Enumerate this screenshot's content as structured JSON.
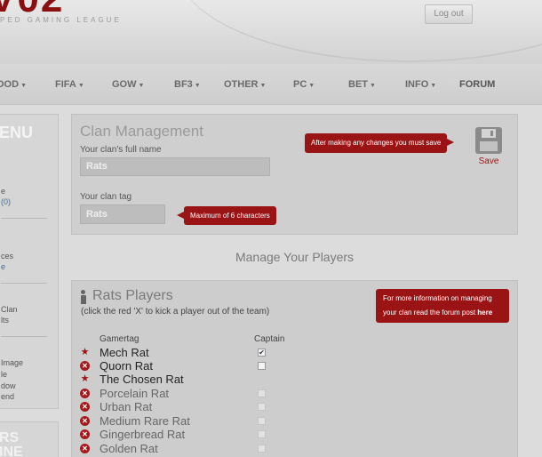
{
  "header": {
    "logo_text": "V02",
    "tagline": "PED GAMING LEAGUE",
    "logout_label": "Log out"
  },
  "nav": {
    "items": [
      {
        "label": "OOD",
        "caret": true
      },
      {
        "label": "FIFA",
        "caret": true
      },
      {
        "label": "GOW",
        "caret": true
      },
      {
        "label": "BF3",
        "caret": true
      },
      {
        "label": "OTHER",
        "caret": true
      },
      {
        "label": "PC",
        "caret": true
      },
      {
        "label": "BET",
        "caret": true
      },
      {
        "label": "INFO",
        "caret": true
      },
      {
        "label": "FORUM",
        "caret": false
      }
    ]
  },
  "sidebar": {
    "title": "ENU",
    "items": [
      "e",
      "(0)",
      "ces",
      "e",
      "Clan",
      "lts",
      "Image",
      "le",
      "dow",
      "end"
    ],
    "bottom_title_1": "RS",
    "bottom_title_2": "INE"
  },
  "clan": {
    "title": "Clan Management",
    "full_name_label": "Your clan's full name",
    "full_name_value": "Rats",
    "tag_label": "Your clan tag",
    "tag_value": "Rats",
    "save_hint": "After making any changes you must save",
    "tag_hint": "Maximum of 6 characters",
    "save_label": "Save"
  },
  "manage": {
    "heading": "Manage Your Players"
  },
  "players": {
    "title": "Rats Players",
    "hint": "(click the red 'X' to kick a player out of the team)",
    "info_line1": "For more information on managing",
    "info_line2_prefix": "your clan read the forum post ",
    "info_link": "here",
    "col_gamertag": "Gamertag",
    "col_captain": "Captain",
    "rows": [
      {
        "name": "Mech Rat",
        "icon": "star",
        "captain": true,
        "faded": false
      },
      {
        "name": "Quorn Rat",
        "icon": "x",
        "captain": false,
        "faded": false
      },
      {
        "name": "The Chosen Rat",
        "icon": "star",
        "captain": null,
        "faded": false
      },
      {
        "name": "Porcelain Rat",
        "icon": "x",
        "captain": false,
        "faded": true
      },
      {
        "name": "Urban Rat",
        "icon": "x",
        "captain": false,
        "faded": true
      },
      {
        "name": "Medium Rare Rat",
        "icon": "x",
        "captain": false,
        "faded": true
      },
      {
        "name": "Gingerbread Rat",
        "icon": "x",
        "captain": false,
        "faded": true
      },
      {
        "name": "Golden Rat",
        "icon": "x",
        "captain": false,
        "faded": true
      }
    ]
  },
  "colors": {
    "accent_red": "#9a1416",
    "background": "#dcdcdc"
  }
}
